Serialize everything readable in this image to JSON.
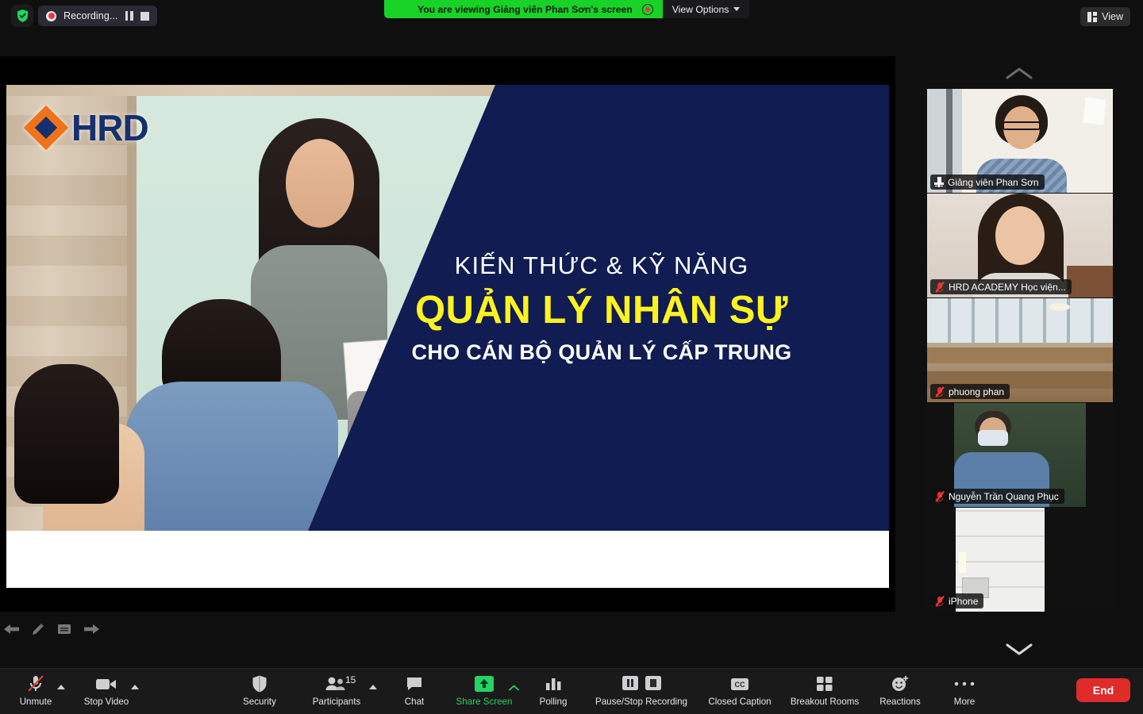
{
  "topbar": {
    "shield_icon": "security-shield-icon",
    "recording": {
      "label": "Recording...",
      "record_icon": "record-dot-icon",
      "pause_icon": "pause-icon",
      "stop_icon": "stop-icon"
    },
    "share_banner": {
      "text": "You are viewing Giảng viên Phan Sơn's screen",
      "indicator_icon": "recording-indicator-icon",
      "view_options": "View Options",
      "chevron_icon": "chevron-down-icon"
    },
    "view_button": {
      "label": "View",
      "icon": "layout-grid-icon"
    }
  },
  "shared_screen": {
    "slide": {
      "logo_text": "HRD",
      "line1": "KIẾN THỨC & KỸ NĂNG",
      "line2": "QUẢN LÝ NHÂN SỰ",
      "line3": "CHO CÁN BỘ QUẢN LÝ CẤP TRUNG",
      "navy_color": "#101c52",
      "highlight_color": "#fff31f",
      "logo_orange": "#f2721a",
      "logo_navy": "#15306e"
    },
    "annotation_tools": [
      {
        "name": "previous-slide",
        "icon": "arrow-left-icon"
      },
      {
        "name": "annotate",
        "icon": "pencil-icon"
      },
      {
        "name": "notes",
        "icon": "note-icon"
      },
      {
        "name": "next-slide",
        "icon": "arrow-right-icon"
      }
    ]
  },
  "filmstrip": {
    "scroll_up_icon": "chevron-up-icon",
    "scroll_down_icon": "chevron-down-icon",
    "participants": [
      {
        "name": "Giảng viên Phan Sơn",
        "status_icon": "pin-icon",
        "active": true
      },
      {
        "name": "HRD ACADEMY Học viện...",
        "status_icon": "mic-muted-icon",
        "active": false
      },
      {
        "name": "phuong phan",
        "status_icon": "mic-muted-icon",
        "active": false
      },
      {
        "name": "Nguyễn Trần Quang Phục",
        "status_icon": "mic-muted-icon",
        "active": false
      },
      {
        "name": "iPhone",
        "status_icon": "mic-muted-icon",
        "active": false
      }
    ]
  },
  "toolbar": {
    "mute": {
      "label": "Unmute",
      "icon": "mic-muted-icon",
      "has_caret": true
    },
    "video": {
      "label": "Stop Video",
      "icon": "video-camera-icon",
      "has_caret": true
    },
    "security": {
      "label": "Security",
      "icon": "shield-icon"
    },
    "participants": {
      "label": "Participants",
      "icon": "people-icon",
      "count": "15",
      "has_caret": true
    },
    "chat": {
      "label": "Chat",
      "icon": "chat-bubble-icon"
    },
    "share": {
      "label": "Share Screen",
      "icon": "share-up-arrow-icon",
      "has_caret": true,
      "color": "#25d366"
    },
    "polling": {
      "label": "Polling",
      "icon": "bar-chart-icon"
    },
    "recording": {
      "label": "Pause/Stop Recording",
      "pause_icon": "pause-icon",
      "stop_icon": "stop-icon"
    },
    "captions": {
      "label": "Closed Caption",
      "icon": "cc-icon"
    },
    "breakout": {
      "label": "Breakout Rooms",
      "icon": "grid-squares-icon"
    },
    "reactions": {
      "label": "Reactions",
      "icon": "smiley-plus-icon"
    },
    "more": {
      "label": "More",
      "icon": "ellipsis-icon"
    },
    "end": {
      "label": "End",
      "color": "#e02b2b"
    }
  }
}
